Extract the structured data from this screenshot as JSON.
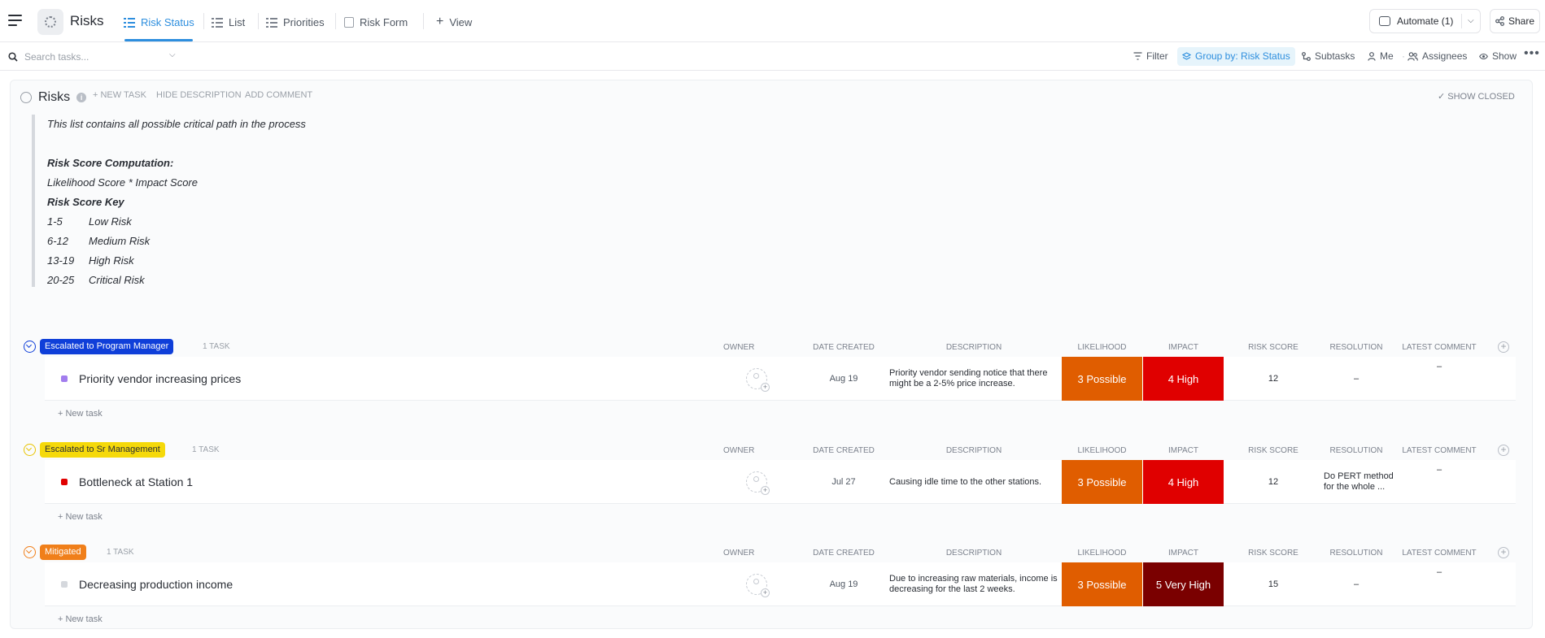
{
  "header": {
    "space_title": "Risks",
    "tabs": [
      {
        "label": "Risk Status",
        "icon": "list-icon",
        "active": true
      },
      {
        "label": "List",
        "icon": "list-icon",
        "active": false
      },
      {
        "label": "Priorities",
        "icon": "list-icon",
        "active": false
      },
      {
        "label": "Risk Form",
        "icon": "form-icon",
        "active": false
      }
    ],
    "add_view_label": "View",
    "automate_label": "Automate (1)",
    "share_label": "Share"
  },
  "filterbar": {
    "search_placeholder": "Search tasks...",
    "filter_label": "Filter",
    "group_by_label": "Group by: Risk Status",
    "subtasks_label": "Subtasks",
    "me_label": "Me",
    "assignees_label": "Assignees",
    "show_label": "Show",
    "more_label": "•••"
  },
  "list": {
    "title": "Risks",
    "actions": {
      "new_task": "+ NEW TASK",
      "hide_description": "HIDE DESCRIPTION",
      "add_comment": "ADD COMMENT"
    },
    "show_closed": "SHOW CLOSED",
    "description": {
      "intro": "This list contains all possible critical path in the process",
      "computation_title": "Risk Score Computation:",
      "computation_formula": "Likelihood Score * Impact Score",
      "key_title": "Risk Score Key",
      "key": [
        {
          "range": "1-5",
          "label": "Low Risk"
        },
        {
          "range": "6-12",
          "label": "Medium Risk"
        },
        {
          "range": "13-19",
          "label": "High Risk"
        },
        {
          "range": "20-25",
          "label": "Critical Risk"
        }
      ]
    }
  },
  "columns": {
    "owner": "OWNER",
    "date_created": "DATE CREATED",
    "description": "DESCRIPTION",
    "likelihood": "LIKELIHOOD",
    "impact": "IMPACT",
    "risk_score": "RISK SCORE",
    "resolution": "RESOLUTION",
    "latest_comment": "LATEST COMMENT"
  },
  "colors": {
    "accent": "#2d8ede",
    "likelihood_possible": "#e05d00",
    "impact_high": "#e00000",
    "impact_very_high": "#7a0000"
  },
  "groups": [
    {
      "name": "Escalated to Program Manager",
      "count": "1 TASK",
      "badge_bg": "#0f3fd9",
      "badge_fg": "#ffffff",
      "new_task": "+ New task",
      "task": {
        "name": "Priority vendor increasing prices",
        "status_color": "#a27dee",
        "date": "Aug 19",
        "description": "Priority vendor sending notice that there might be a 2-5% price increase.",
        "likelihood": "3 Possible",
        "impact": "4 High",
        "impact_color": "#e00000",
        "risk_score": "12",
        "resolution": "–",
        "latest_comment": "–"
      }
    },
    {
      "name": "Escalated to Sr Management",
      "count": "1 TASK",
      "badge_bg": "#f5d90a",
      "badge_fg": "#292d34",
      "new_task": "+ New task",
      "task": {
        "name": "Bottleneck at Station 1",
        "status_color": "#e00000",
        "date": "Jul 27",
        "description": "Causing idle time to the other stations.",
        "likelihood": "3 Possible",
        "impact": "4 High",
        "impact_color": "#e00000",
        "risk_score": "12",
        "resolution": "Do PERT method for the whole ...",
        "latest_comment": "–"
      }
    },
    {
      "name": "Mitigated",
      "count": "1 TASK",
      "badge_bg": "#f07f1a",
      "badge_fg": "#ffffff",
      "new_task": "+ New task",
      "task": {
        "name": "Decreasing production income",
        "status_color": "#d5d8dd",
        "date": "Aug 19",
        "description": "Due to increasing raw materials, income is decreasing for the last 2 weeks.",
        "likelihood": "3 Possible",
        "impact": "5 Very High",
        "impact_color": "#7a0000",
        "risk_score": "15",
        "resolution": "–",
        "latest_comment": "–"
      }
    }
  ]
}
